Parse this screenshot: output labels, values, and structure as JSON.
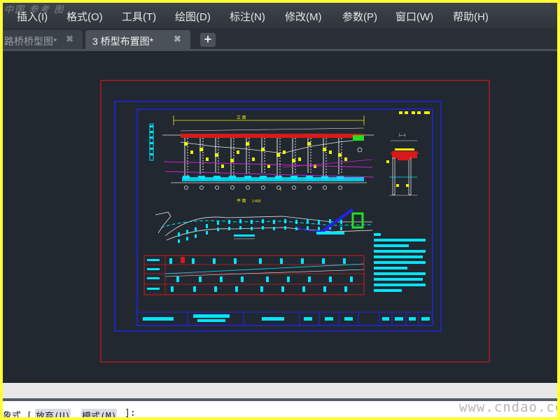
{
  "window": {
    "ghost_title": "中国 参考 图"
  },
  "menubar": {
    "items": [
      {
        "label": "插入(I)"
      },
      {
        "label": "格式(O)"
      },
      {
        "label": "工具(T)"
      },
      {
        "label": "绘图(D)"
      },
      {
        "label": "标注(N)"
      },
      {
        "label": "修改(M)"
      },
      {
        "label": "参数(P)"
      },
      {
        "label": "窗口(W)"
      },
      {
        "label": "帮助(H)"
      }
    ]
  },
  "tabs": [
    {
      "label": "路桥桥型图*",
      "close": "✖",
      "active": false
    },
    {
      "label": "3 桥型布置图*",
      "close": "✖",
      "active": true
    }
  ],
  "new_tab": "+",
  "drawing": {
    "elevation_title": "立 面",
    "plan_title": "平 面",
    "section_label": "I—I",
    "section_marker": "I",
    "scale_note": "1:400",
    "colors": {
      "canvas": "#212830",
      "outer_border": "#d01818",
      "inner_border": "#2222ee",
      "cyan": "#00e5ff",
      "red": "#d81a1a",
      "magenta": "#d21fd2",
      "yellow": "#f2f200",
      "white": "#e8e8e8",
      "green": "#22e022"
    }
  },
  "command_line": {
    "prompt": "象式 [",
    "option_discard": "放弃(U)",
    "option_mode": "模式(M)",
    "tail": "]:"
  },
  "watermark": "www.cndao.com"
}
